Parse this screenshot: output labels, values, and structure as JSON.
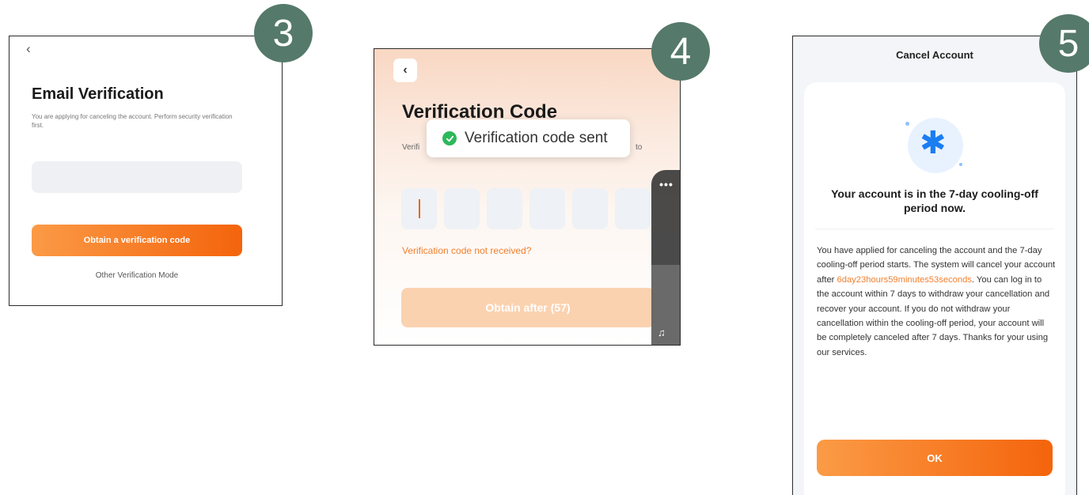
{
  "badges": {
    "step3": "3",
    "step4": "4",
    "step5": "5"
  },
  "panel3": {
    "back_icon": "‹",
    "title": "Email Verification",
    "description": "You are applying for canceling the account. Perform security verification first.",
    "email_value": "",
    "obtain_button": "Obtain a verification code",
    "other_mode_link": "Other Verification Mode"
  },
  "panel4": {
    "back_icon": "‹",
    "title": "Verification Code",
    "subtitle_left": "Verifi",
    "subtitle_right": "to",
    "toast": "Verification code sent",
    "code_digits": [
      "",
      "",
      "",
      "",
      "",
      ""
    ],
    "not_received_link": "Verification code not received?",
    "obtain_after_button": "Obtain after (57)",
    "sidebar_more": "•••",
    "sidebar_sound": "♫"
  },
  "panel5": {
    "header_title": "Cancel Account",
    "icon": "snowflake-icon",
    "headline": "Your account is in the 7-day cooling-off period now.",
    "body_part1": "You have applied for canceling the account and the 7-day cooling-off period starts. The system will cancel your account after ",
    "countdown": "6day23hours59minutes53seconds",
    "body_part2": ". You can log in to the account within 7 days to withdraw your cancellation and recover your account. If you do not withdraw your cancellation within the cooling-off period, your account will be completely canceled after 7 days. Thanks for your using our services.",
    "ok_button": "OK"
  },
  "colors": {
    "badge": "#55796a",
    "accent_orange": "#f4640c",
    "accent_orange_light": "#fb9a46",
    "link_orange": "#f0802f",
    "success_green": "#2eb85c",
    "snowflake_blue": "#1b7df2"
  }
}
